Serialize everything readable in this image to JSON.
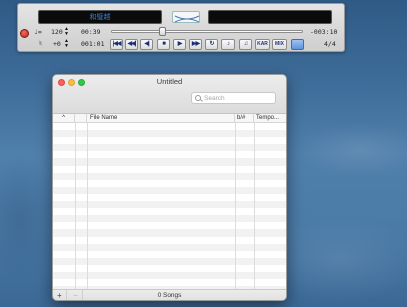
{
  "player": {
    "left_display": "和璧越",
    "right_display": "",
    "tempo_label": "♩=",
    "tempo_value": "120",
    "transpose_label": "♮",
    "transpose_value": "+0",
    "elapsed": "00:39",
    "remaining": "-003:10",
    "position": "001:01",
    "time_signature": "4/4",
    "progress": 0.26,
    "buttons": [
      {
        "name": "skip-to-start-button",
        "glyph": "|◀◀"
      },
      {
        "name": "previous-song-button",
        "glyph": "◀◀|"
      },
      {
        "name": "rewind-button",
        "glyph": "◀|"
      },
      {
        "name": "stop-button",
        "glyph": "■"
      },
      {
        "name": "play-button",
        "glyph": "▶"
      },
      {
        "name": "fast-forward-button",
        "glyph": "▶▶"
      },
      {
        "name": "repeat-button",
        "glyph": "↻"
      },
      {
        "name": "mute-button",
        "glyph": "♪"
      },
      {
        "name": "metronome-button",
        "glyph": "♫"
      },
      {
        "name": "karaoke-button",
        "label": "KAR"
      },
      {
        "name": "mixer-button",
        "label": "MIX"
      },
      {
        "name": "view-toggle-button",
        "glyph": ""
      }
    ]
  },
  "window": {
    "title": "Untitled",
    "search_placeholder": "Search",
    "columns": [
      "",
      "File Name",
      "b/#",
      "Tempo..."
    ],
    "sort_indicator": "^",
    "song_count": "0 Songs",
    "add_label": "+",
    "remove_label": "−"
  },
  "colors": {
    "desktop": "#3d6b98",
    "lcd_text": "#3a7fd0",
    "close": "#fc605c",
    "minimize": "#fdbc40",
    "zoom": "#34c84a"
  }
}
